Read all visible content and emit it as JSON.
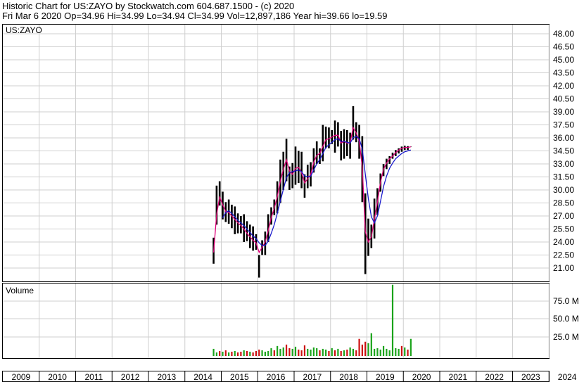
{
  "header": {
    "line1": "Historic Chart for US:ZAYO by Stockwatch.com 604.687.1500 - (c) 2020",
    "line2": "Fri Mar  6 2020   Op=34.96   Hi=34.99   Lo=34.94   Cl=34.99   Vol=12,897,186   Year hi=39.66   lo=19.59"
  },
  "colors": {
    "price_bar": "#000000",
    "ma_short": "#e0007a",
    "ma_long": "#1a1acc",
    "volume_up": "#1aa31a",
    "volume_down": "#cc1010",
    "grid": "#cfcfcf"
  },
  "chart_data": [
    {
      "type": "line",
      "panel_label": "US:ZAYO",
      "y_ticks": [
        "48.00",
        "46.50",
        "45.00",
        "43.50",
        "42.00",
        "40.50",
        "39.00",
        "37.50",
        "36.00",
        "34.50",
        "33.00",
        "31.50",
        "30.00",
        "28.50",
        "27.00",
        "25.50",
        "24.00",
        "22.50",
        "21.00"
      ],
      "ylim": [
        19.5,
        49.0
      ],
      "x_ticks": [
        "2009",
        "2010",
        "2011",
        "2012",
        "2013",
        "2014",
        "2015",
        "2016",
        "2017",
        "2018",
        "2019",
        "2020",
        "2021",
        "2022",
        "2023",
        "2024"
      ],
      "grid": true,
      "series": [
        {
          "x": [
            "2014-10",
            "2014-11",
            "2014-12",
            "2015-01",
            "2015-02",
            "2015-03",
            "2015-04",
            "2015-05",
            "2015-06",
            "2015-07",
            "2015-08",
            "2015-09",
            "2015-10",
            "2015-11",
            "2015-12",
            "2016-01",
            "2016-02",
            "2016-03",
            "2016-04",
            "2016-05",
            "2016-06",
            "2016-07",
            "2016-08",
            "2016-09",
            "2016-10",
            "2016-11",
            "2016-12",
            "2017-01",
            "2017-02",
            "2017-03",
            "2017-04",
            "2017-05",
            "2017-06",
            "2017-07",
            "2017-08",
            "2017-09",
            "2017-10",
            "2017-11",
            "2017-12",
            "2018-01",
            "2018-02",
            "2018-03",
            "2018-04",
            "2018-05",
            "2018-06",
            "2018-07",
            "2018-08",
            "2018-09",
            "2018-10",
            "2018-11",
            "2018-12",
            "2019-01",
            "2019-02",
            "2019-03",
            "2019-04",
            "2019-05",
            "2019-06",
            "2019-07",
            "2019-08",
            "2019-09",
            "2019-10",
            "2019-11",
            "2019-12",
            "2020-01",
            "2020-02",
            "2020-03"
          ],
          "high": [
            24.5,
            30.5,
            31.0,
            29.8,
            28.6,
            28.9,
            28.3,
            28.1,
            27.3,
            27.0,
            27.2,
            26.4,
            26.0,
            25.8,
            24.9,
            22.5,
            24.2,
            25.2,
            27.2,
            28.0,
            28.9,
            31.0,
            33.5,
            34.4,
            35.9,
            32.7,
            33.1,
            35.0,
            34.5,
            34.4,
            31.8,
            32.9,
            33.2,
            34.8,
            35.6,
            34.8,
            37.5,
            37.3,
            37.2,
            36.9,
            38.0,
            37.8,
            36.8,
            37.0,
            36.9,
            36.6,
            39.66,
            37.8,
            37.5,
            36.2,
            29.6,
            26.7,
            26.0,
            29.0,
            30.2,
            31.9,
            33.0,
            33.6,
            33.9,
            34.3,
            34.6,
            34.8,
            35.0,
            35.1,
            35.05,
            34.99
          ],
          "low": [
            21.5,
            26.0,
            28.2,
            26.6,
            26.3,
            26.1,
            25.6,
            24.9,
            25.0,
            25.0,
            24.0,
            24.1,
            23.3,
            23.0,
            23.1,
            19.9,
            22.5,
            22.5,
            24.0,
            26.0,
            27.1,
            27.3,
            28.5,
            30.0,
            31.0,
            30.0,
            30.2,
            30.6,
            30.8,
            30.2,
            29.1,
            30.2,
            30.4,
            32.0,
            33.0,
            33.0,
            33.3,
            34.8,
            34.8,
            35.3,
            34.3,
            35.0,
            33.4,
            33.6,
            33.9,
            33.6,
            35.8,
            35.5,
            33.6,
            28.6,
            20.3,
            22.4,
            23.3,
            24.4,
            27.1,
            29.8,
            31.6,
            32.4,
            33.0,
            33.6,
            33.9,
            34.2,
            34.4,
            34.6,
            34.6,
            34.94
          ]
        },
        {
          "name": "",
          "values": [
            22.8,
            27.2,
            29.2,
            28.3,
            27.5,
            27.4,
            27.0,
            26.6,
            26.2,
            25.9,
            25.5,
            25.0,
            24.6,
            24.2,
            23.9,
            22.8,
            23.4,
            24.0,
            25.3,
            26.8,
            27.9,
            29.2,
            31.0,
            32.4,
            33.5,
            32.2,
            31.8,
            32.5,
            32.6,
            32.0,
            30.8,
            31.3,
            31.8,
            33.2,
            34.0,
            34.2,
            35.0,
            35.8,
            35.9,
            36.1,
            36.3,
            36.3,
            35.4,
            35.6,
            35.4,
            35.4,
            37.2,
            36.6,
            35.6,
            32.6,
            25.2,
            24.0,
            24.6,
            26.6,
            28.6,
            30.9,
            32.4,
            33.1,
            33.6,
            33.9,
            34.3,
            34.6,
            34.8,
            34.9,
            34.9,
            34.98
          ]
        },
        {
          "name": "",
          "values": [
            null,
            null,
            null,
            26.8,
            27.4,
            27.6,
            27.3,
            26.9,
            26.5,
            26.2,
            25.9,
            25.5,
            25.1,
            24.7,
            24.4,
            23.9,
            23.6,
            23.6,
            24.1,
            25.0,
            26.0,
            27.3,
            28.7,
            30.1,
            31.4,
            32.0,
            32.1,
            32.2,
            32.3,
            32.1,
            31.6,
            31.5,
            31.6,
            32.3,
            33.0,
            33.5,
            34.2,
            34.9,
            35.2,
            35.5,
            35.8,
            35.9,
            35.6,
            35.6,
            35.5,
            35.4,
            36.0,
            36.2,
            35.9,
            34.7,
            31.8,
            29.0,
            26.9,
            26.2,
            27.0,
            28.7,
            30.4,
            31.6,
            32.5,
            33.1,
            33.6,
            33.9,
            34.2,
            34.4,
            34.5,
            34.6
          ]
        }
      ]
    },
    {
      "type": "bar",
      "panel_label": "Volume",
      "y_ticks": [
        "75.0 M",
        "50.0 M",
        "25.0 M"
      ],
      "ylim": [
        0,
        100
      ],
      "x": [
        "2014-10",
        "2014-11",
        "2014-12",
        "2015-01",
        "2015-02",
        "2015-03",
        "2015-04",
        "2015-05",
        "2015-06",
        "2015-07",
        "2015-08",
        "2015-09",
        "2015-10",
        "2015-11",
        "2015-12",
        "2016-01",
        "2016-02",
        "2016-03",
        "2016-04",
        "2016-05",
        "2016-06",
        "2016-07",
        "2016-08",
        "2016-09",
        "2016-10",
        "2016-11",
        "2016-12",
        "2017-01",
        "2017-02",
        "2017-03",
        "2017-04",
        "2017-05",
        "2017-06",
        "2017-07",
        "2017-08",
        "2017-09",
        "2017-10",
        "2017-11",
        "2017-12",
        "2018-01",
        "2018-02",
        "2018-03",
        "2018-04",
        "2018-05",
        "2018-06",
        "2018-07",
        "2018-08",
        "2018-09",
        "2018-10",
        "2018-11",
        "2018-12",
        "2019-01",
        "2019-02",
        "2019-03",
        "2019-04",
        "2019-05",
        "2019-06",
        "2019-07",
        "2019-08",
        "2019-09",
        "2019-10",
        "2019-11",
        "2019-12",
        "2020-01",
        "2020-02",
        "2020-03"
      ],
      "values": [
        8,
        3,
        5,
        4,
        6,
        3,
        4,
        5,
        3,
        4,
        6,
        5,
        4,
        3,
        5,
        7,
        6,
        4,
        5,
        9,
        6,
        12,
        8,
        10,
        14,
        9,
        8,
        11,
        7,
        6,
        13,
        8,
        7,
        10,
        9,
        6,
        8,
        7,
        5,
        9,
        6,
        8,
        5,
        6,
        7,
        10,
        8,
        6,
        22,
        14,
        18,
        16,
        30,
        8,
        9,
        7,
        12,
        8,
        6,
        98,
        9,
        8,
        12,
        10,
        7,
        22
      ],
      "series_up": [
        true,
        true,
        false,
        true,
        false,
        true,
        false,
        true,
        false,
        false,
        true,
        false,
        true,
        false,
        false,
        false,
        true,
        true,
        true,
        true,
        false,
        true,
        true,
        true,
        false,
        false,
        true,
        true,
        false,
        false,
        false,
        true,
        true,
        true,
        true,
        false,
        true,
        true,
        false,
        true,
        false,
        true,
        false,
        true,
        false,
        true,
        true,
        false,
        false,
        false,
        false,
        true,
        true,
        true,
        true,
        true,
        true,
        true,
        true,
        true,
        true,
        true,
        false,
        true,
        false,
        true
      ]
    }
  ]
}
